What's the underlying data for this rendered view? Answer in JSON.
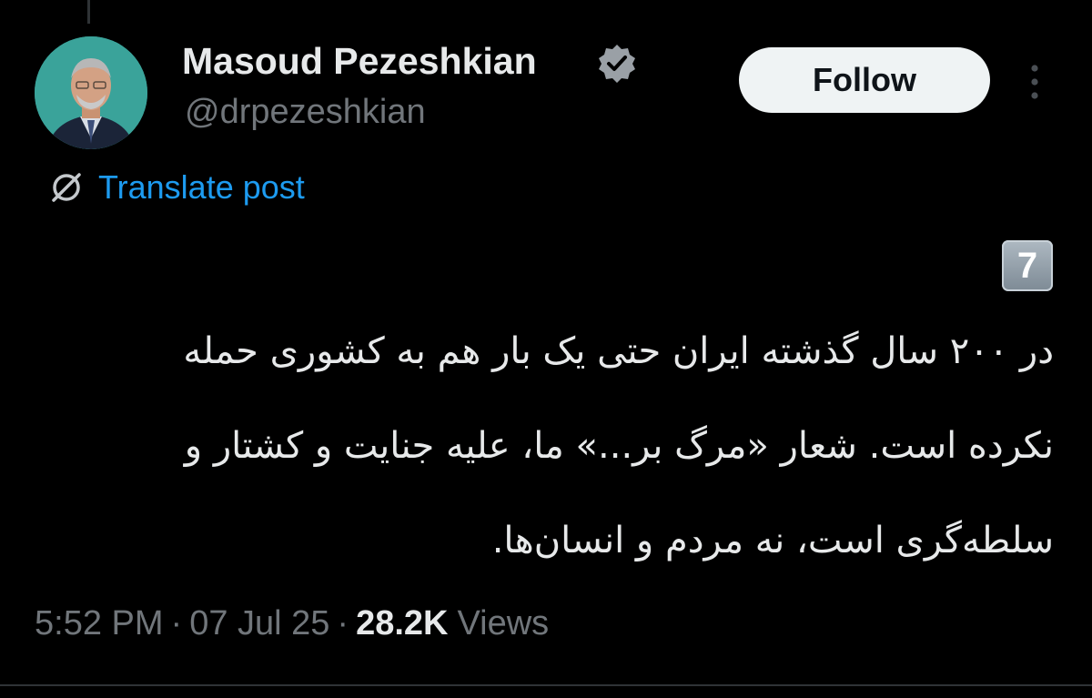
{
  "author": {
    "display_name": "Masoud Pezeshkian",
    "handle": "@drpezeshkian",
    "avatar_icon": "profile-photo",
    "verified_icon": "verified-badge-icon"
  },
  "header": {
    "follow_label": "Follow",
    "more_icon": "more-vertical-icon"
  },
  "translate": {
    "label": "Translate post",
    "icon": "globe-slash-icon",
    "color": "#1d9bf0"
  },
  "post": {
    "thread_badge": "7",
    "lines": [
      "در ۲۰۰ سال گذشته ایران حتی یک بار هم به کشوری حمله",
      "نکرده است. شعار «مرگ بر...» ما، علیه جنایت و کشتار و",
      "سلطه‌گری است، نه مردم و انسان‌ها."
    ]
  },
  "meta": {
    "time": "5:52 PM",
    "separator": "·",
    "date": "07 Jul 25",
    "views_count": "28.2K",
    "views_label": "Views"
  },
  "colors": {
    "background": "#000000",
    "text_primary": "#e7e9ea",
    "text_secondary": "#71767b",
    "accent": "#1d9bf0",
    "button_bg": "#eff3f4"
  }
}
